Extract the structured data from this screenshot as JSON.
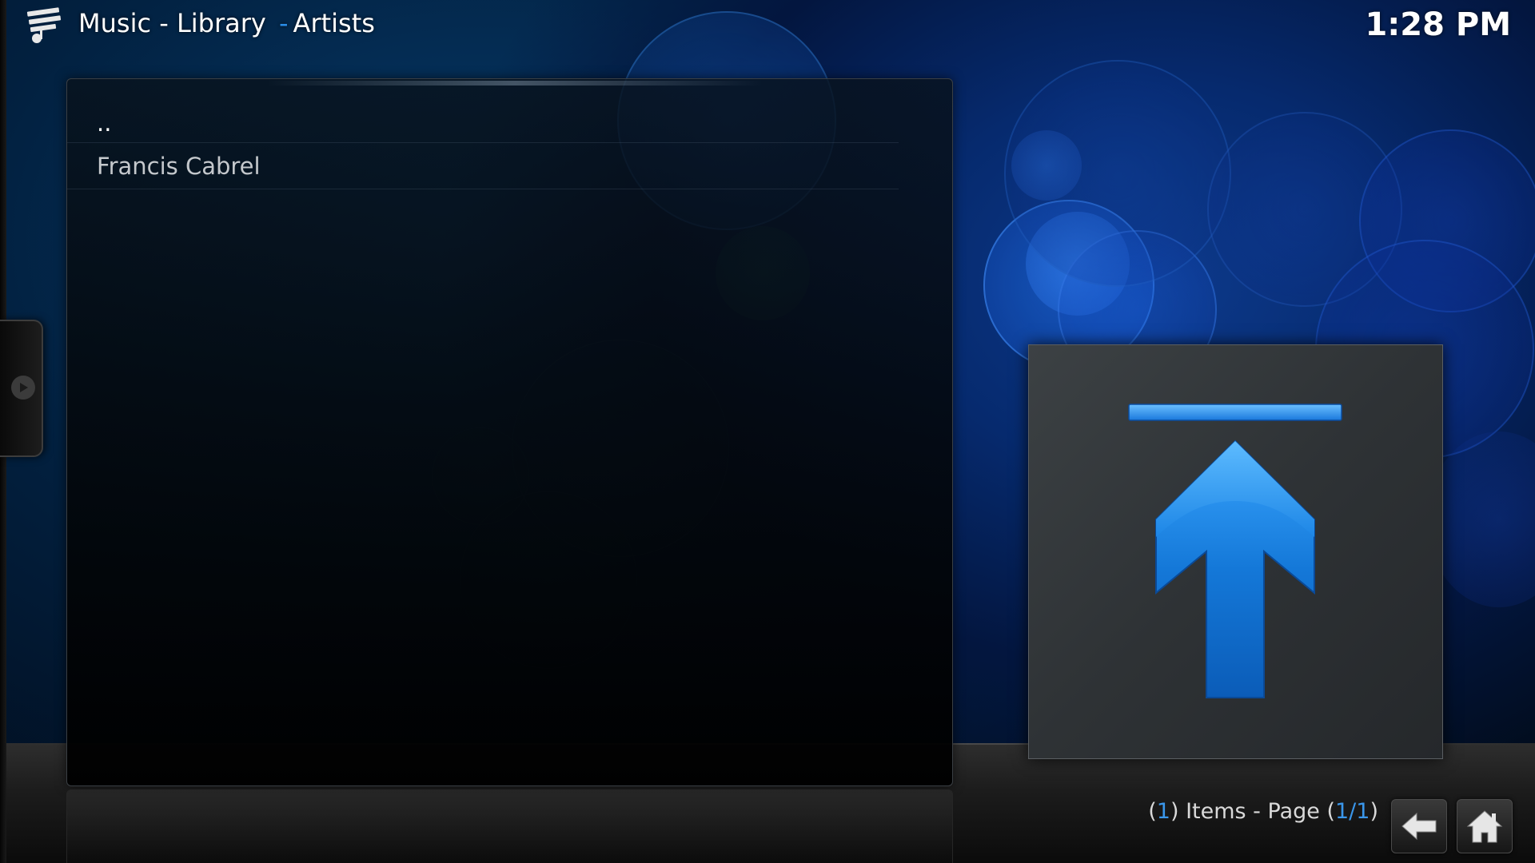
{
  "header": {
    "section": "Music",
    "sep1": "-",
    "library": "Library",
    "sep2": "-",
    "view": "Artists",
    "icon": "music-library-icon"
  },
  "clock": "1:28 PM",
  "list": {
    "items": [
      {
        "label": ".."
      },
      {
        "label": "Francis Cabrel"
      }
    ]
  },
  "thumbnail": {
    "icon": "parent-folder-up-arrow-icon"
  },
  "footer": {
    "count_open": "(",
    "count": "1",
    "count_close": ")",
    "items_text": " Items - Page ",
    "page_open": "(",
    "page": "1/1",
    "page_close": ")"
  },
  "buttons": {
    "back_icon": "back-arrow-icon",
    "home_icon": "home-icon"
  },
  "colors": {
    "accent": "#2a8de8",
    "text": "#ffffff",
    "muted": "#c4c8cc"
  }
}
